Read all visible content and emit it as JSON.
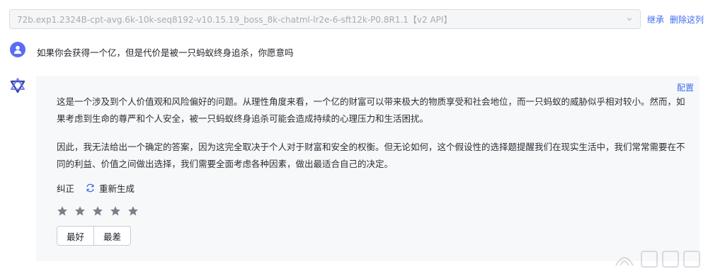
{
  "model_select": {
    "value": "72b.exp1.2324B-cpt-avg.6k-10k-seq8192-v10.15.19_boss_8k-chatml-lr2e-6-sft12k-P0.8R1.1【v2 API】"
  },
  "top_links": {
    "inherit": "继承",
    "delete_column": "删除这列"
  },
  "user": {
    "question": "如果你会获得一个亿，但是代价是被一只蚂蚁终身追杀，你愿意吗"
  },
  "answer": {
    "config_label": "配置",
    "paragraphs": [
      "这是一个涉及到个人价值观和风险偏好的问题。从理性角度来看，一个亿的财富可以带来极大的物质享受和社会地位，而一只蚂蚁的威胁似乎相对较小。然而，如果考虑到生命的尊严和个人安全，被一只蚂蚁终身追杀可能会造成持续的心理压力和生活困扰。",
      "因此，我无法给出一个确定的答案，因为这完全取决于个人对于财富和安全的权衡。但无论如何，这个假设性的选择题提醒我们在现实生活中，我们常常需要在不同的利益、价值之间做出选择，我们需要全面考虑各种因素，做出最适合自己的决定。"
    ],
    "fix_label": "纠正",
    "regenerate_label": "重新生成",
    "rating_stars": 0,
    "rating_max": 5,
    "best_label": "最好",
    "worst_label": "最差"
  },
  "icons": {
    "user_avatar": "user-icon",
    "bot_avatar": "bot-logo-icon",
    "regenerate": "refresh-icon",
    "star": "star-icon",
    "dropdown": "chevron-down-icon"
  },
  "colors": {
    "accent": "#3d6bf0",
    "user_avatar_bg": "#5a6cf5",
    "panel_bg": "#f7f8fa",
    "star": "#7a8089"
  }
}
